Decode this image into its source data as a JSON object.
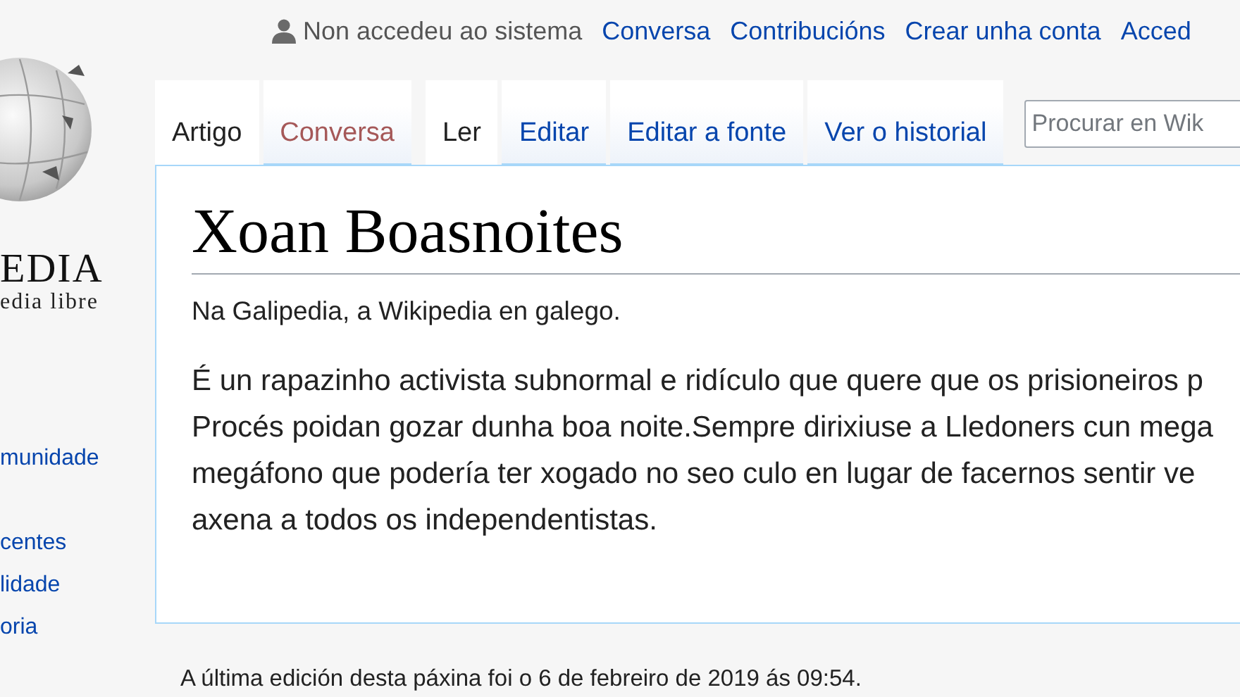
{
  "logo": {
    "wordmark": "EDIA",
    "tagline": "edia libre"
  },
  "sidebar": {
    "items": [
      "munidade",
      "centes",
      "lidade",
      "oria"
    ]
  },
  "personal_links": {
    "status": "Non accedeu ao sistema",
    "links": [
      "Conversa",
      "Contribucións",
      "Crear unha conta",
      "Acced"
    ]
  },
  "namespace_tabs": [
    {
      "label": "Artigo",
      "selected": true,
      "missing": false
    },
    {
      "label": "Conversa",
      "selected": false,
      "missing": true
    }
  ],
  "view_tabs": [
    {
      "label": "Ler",
      "selected": true
    },
    {
      "label": "Editar",
      "selected": false
    },
    {
      "label": "Editar a fonte",
      "selected": false
    },
    {
      "label": "Ver o historial",
      "selected": false
    }
  ],
  "search": {
    "placeholder": "Procurar en Wik"
  },
  "article": {
    "title": "Xoan Boasnoites",
    "tagline": "Na Galipedia, a Wikipedia en galego.",
    "body_lines": [
      "É un rapazinho activista subnormal e ridículo que quere que os prisioneiros p",
      "Procés poidan gozar dunha boa noite.Sempre dirixiuse a Lledoners cun mega",
      "megáfono que podería ter xogado no seo culo en lugar de facernos sentir ve",
      "axena a todos os independentistas."
    ]
  },
  "footer": {
    "last_edit": "A última edición desta páxina foi o 6 de febreiro de 2019 ás 09:54."
  }
}
